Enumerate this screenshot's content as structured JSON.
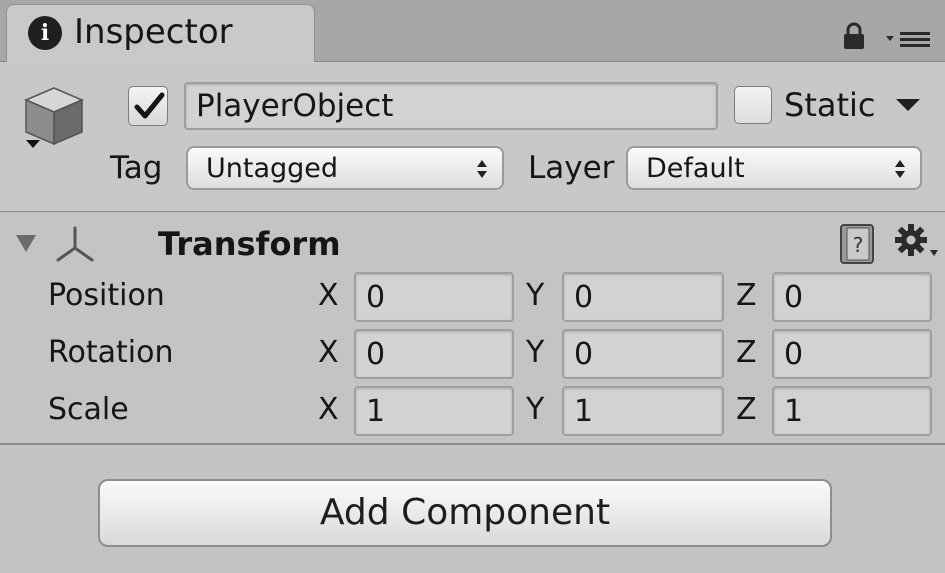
{
  "tab": {
    "title": "Inspector",
    "info_glyph": "i"
  },
  "object": {
    "active": true,
    "name": "PlayerObject",
    "static_label": "Static",
    "static_checked": false,
    "tag_label": "Tag",
    "tag_value": "Untagged",
    "layer_label": "Layer",
    "layer_value": "Default"
  },
  "transform": {
    "title": "Transform",
    "axes": [
      "X",
      "Y",
      "Z"
    ],
    "rows": [
      {
        "label": "Position",
        "values": [
          "0",
          "0",
          "0"
        ]
      },
      {
        "label": "Rotation",
        "values": [
          "0",
          "0",
          "0"
        ]
      },
      {
        "label": "Scale",
        "values": [
          "1",
          "1",
          "1"
        ]
      }
    ]
  },
  "add_component_label": "Add Component",
  "icons": {
    "tab": "info-icon",
    "lock": "lock-icon",
    "menu": "tab-menu-icon",
    "object": "cube-icon",
    "foldout": "foldout-arrow-icon",
    "component": "transform-icon",
    "help": "help-book-icon",
    "settings": "gear-icon"
  }
}
